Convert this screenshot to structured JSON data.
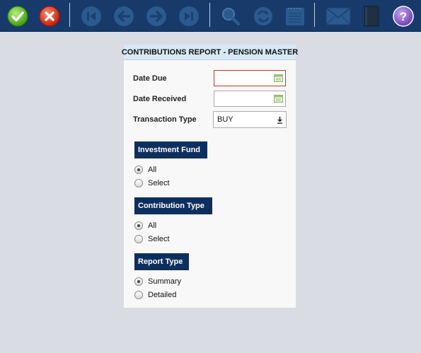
{
  "toolbar": {
    "buttons": [
      {
        "icon": "check-icon",
        "label": "OK"
      },
      {
        "icon": "cancel-icon",
        "label": "Cancel"
      },
      {
        "icon": "first-icon",
        "label": "First"
      },
      {
        "icon": "previous-icon",
        "label": "Previous"
      },
      {
        "icon": "next-icon",
        "label": "Next"
      },
      {
        "icon": "last-icon",
        "label": "Last"
      },
      {
        "icon": "search-icon",
        "label": "Search"
      },
      {
        "icon": "refresh-icon",
        "label": "Refresh"
      },
      {
        "icon": "notepad-icon",
        "label": "Notes"
      },
      {
        "icon": "mail-icon",
        "label": "Email"
      },
      {
        "icon": "book-icon",
        "label": "Book"
      },
      {
        "icon": "help-icon",
        "label": "Help",
        "glyph": "?"
      }
    ]
  },
  "panel": {
    "title": "CONTRIBUTIONS REPORT - PENSION MASTER",
    "fields": {
      "date_due": {
        "label": "Date Due",
        "value": ""
      },
      "date_received": {
        "label": "Date Received",
        "value": ""
      },
      "transaction_type": {
        "label": "Transaction Type",
        "value": "BUY"
      }
    },
    "sections": [
      {
        "title": "Investment Fund",
        "options": [
          "All",
          "Select"
        ],
        "selected": "All"
      },
      {
        "title": "Contribution Type",
        "options": [
          "All",
          "Select"
        ],
        "selected": "All"
      },
      {
        "title": "Report Type",
        "options": [
          "Summary",
          "Detailed"
        ],
        "selected": "Summary"
      }
    ]
  },
  "colors": {
    "toolbar_bg": "#173a6b",
    "section_header_bg": "#0d2f5e",
    "panel_header_bg": "#d6e9f5",
    "required_border": "#c0392b",
    "page_bg": "#d9dde3"
  }
}
